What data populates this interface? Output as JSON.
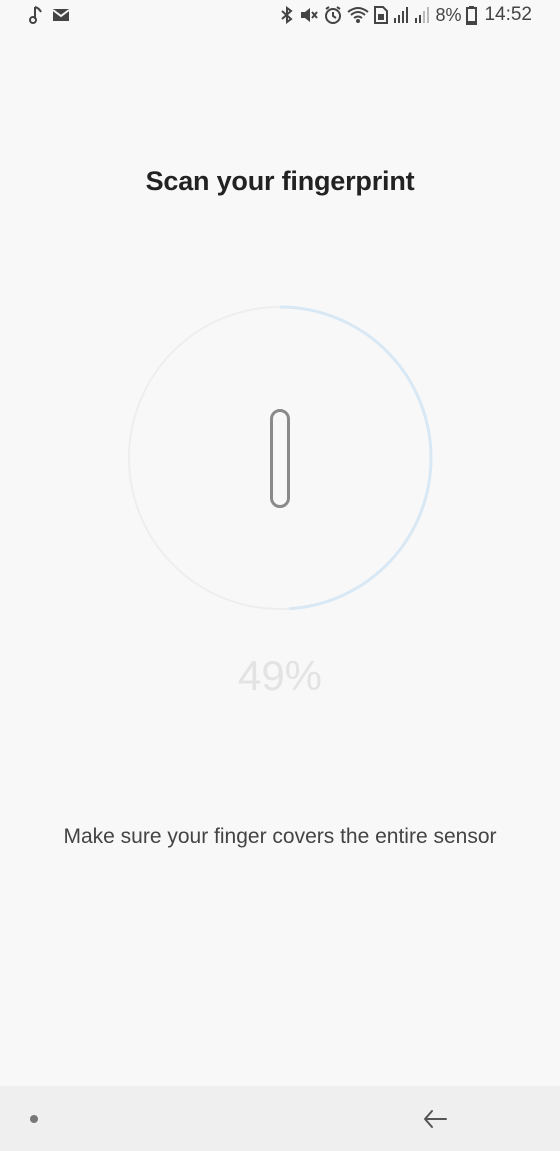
{
  "status_bar": {
    "left_icons": [
      "music-note-icon",
      "mail-icon"
    ],
    "right_icons": [
      "bluetooth-icon",
      "mute-icon",
      "alarm-icon",
      "wifi-icon",
      "sim-icon",
      "signal-icon",
      "signal-weak-icon",
      "battery-icon"
    ],
    "battery_percent": "8%",
    "time": "14:52"
  },
  "enrollment": {
    "title": "Scan your fingerprint",
    "progress_text": "49%",
    "progress_value": 0.49,
    "instruction": "Make sure your finger covers the entire sensor",
    "ring_color": "#d8e8f5",
    "ring_track_color": "#eeeeee"
  },
  "nav_bar": {
    "icons": [
      "recents-dot-icon",
      "back-arrow-icon"
    ]
  }
}
